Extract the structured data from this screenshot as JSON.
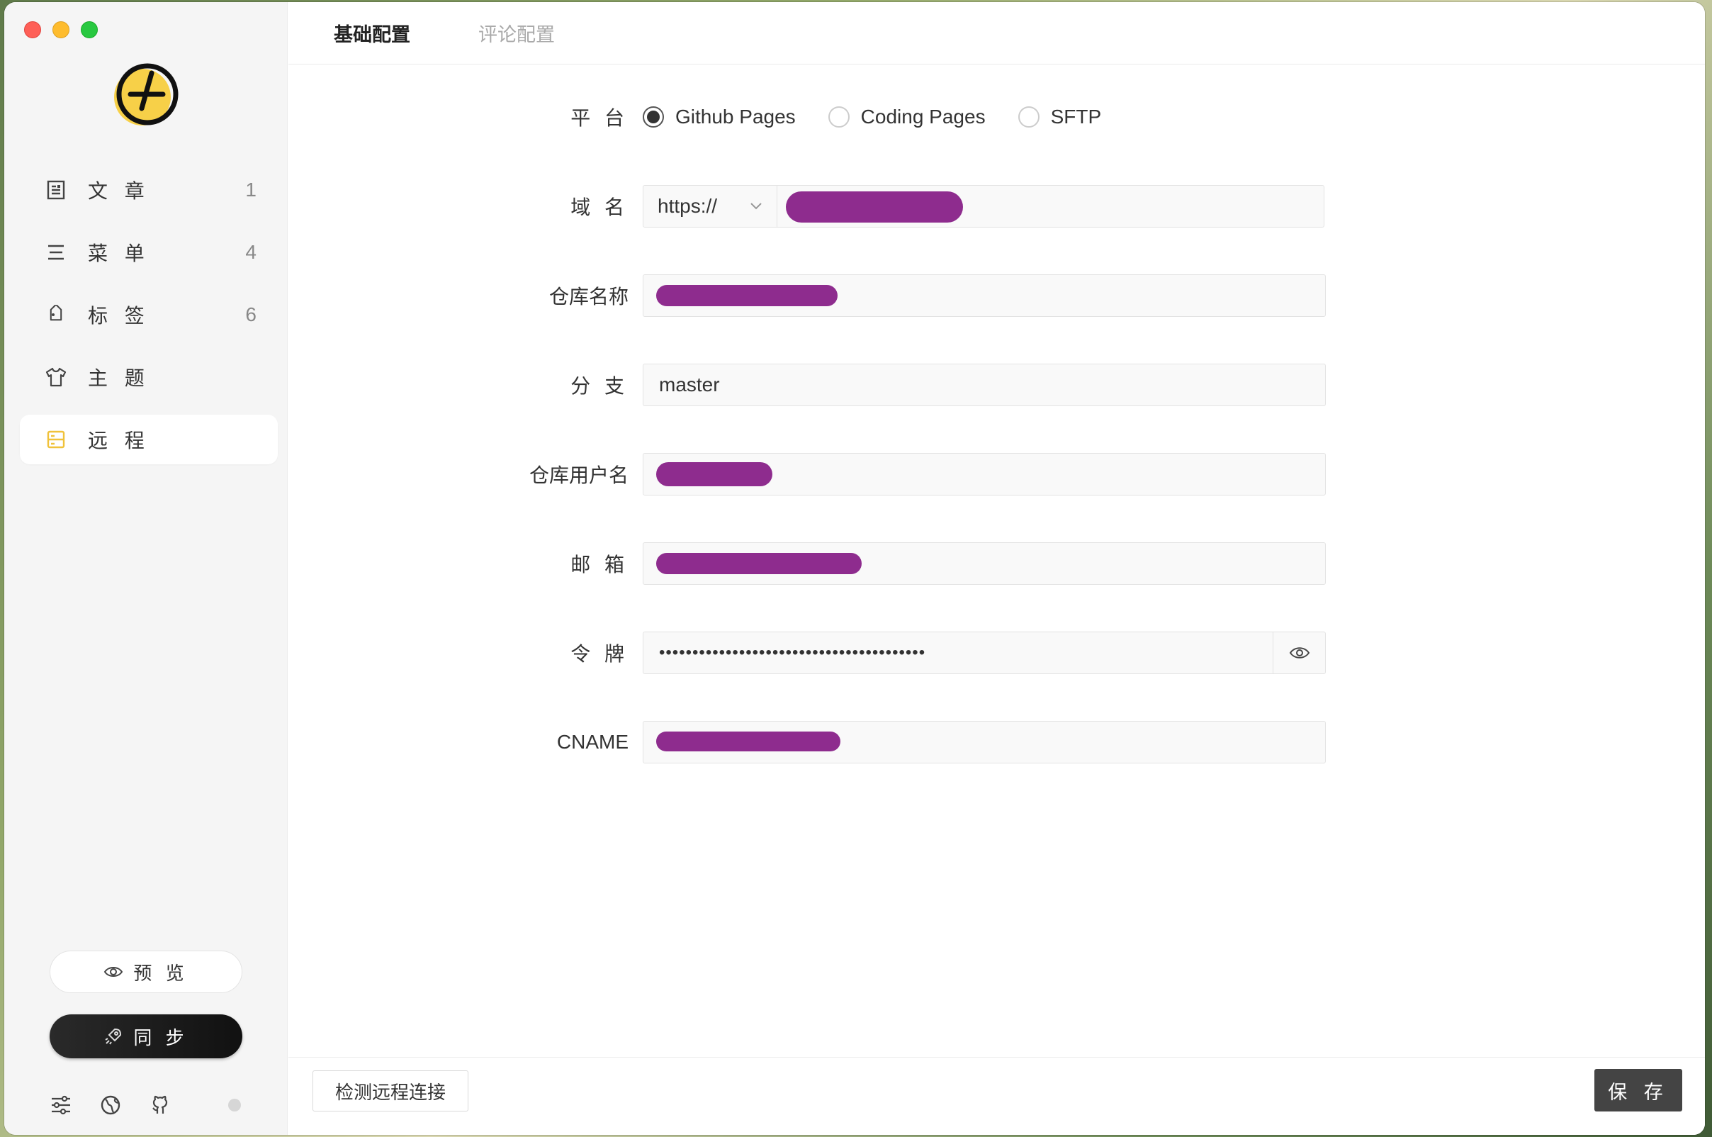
{
  "sidebar": {
    "nav": [
      {
        "label": "文 章",
        "count": "1",
        "icon": "article-icon"
      },
      {
        "label": "菜 单",
        "count": "4",
        "icon": "menu-icon"
      },
      {
        "label": "标 签",
        "count": "6",
        "icon": "tag-icon"
      },
      {
        "label": "主 题",
        "count": "",
        "icon": "theme-shirt-icon"
      },
      {
        "label": "远 程",
        "count": "",
        "icon": "remote-server-icon",
        "active": true
      }
    ],
    "preview_label": "预 览",
    "sync_label": "同 步"
  },
  "tabs": [
    {
      "label": "基础配置",
      "active": true
    },
    {
      "label": "评论配置",
      "active": false
    }
  ],
  "form": {
    "platform": {
      "label": "平 台",
      "options": [
        "Github Pages",
        "Coding Pages",
        "SFTP"
      ],
      "selected": "Github Pages"
    },
    "domain": {
      "label": "域 名",
      "protocol": "https://",
      "value": ""
    },
    "repo_name": {
      "label": "仓库名称",
      "value": ""
    },
    "branch": {
      "label": "分 支",
      "value": "master"
    },
    "repo_user": {
      "label": "仓库用户名",
      "value": ""
    },
    "email": {
      "label": "邮 箱",
      "value": ""
    },
    "token": {
      "label": "令 牌",
      "value": "••••••••••••••••••••••••••••••••••••••••"
    },
    "cname": {
      "label": "CNAME",
      "value": ""
    }
  },
  "footer": {
    "check_label": "检测远程连接",
    "save_label": "保 存"
  },
  "colors": {
    "accent": "#f7d048",
    "redaction": "#8e2c8e",
    "save_button": "#444444"
  }
}
